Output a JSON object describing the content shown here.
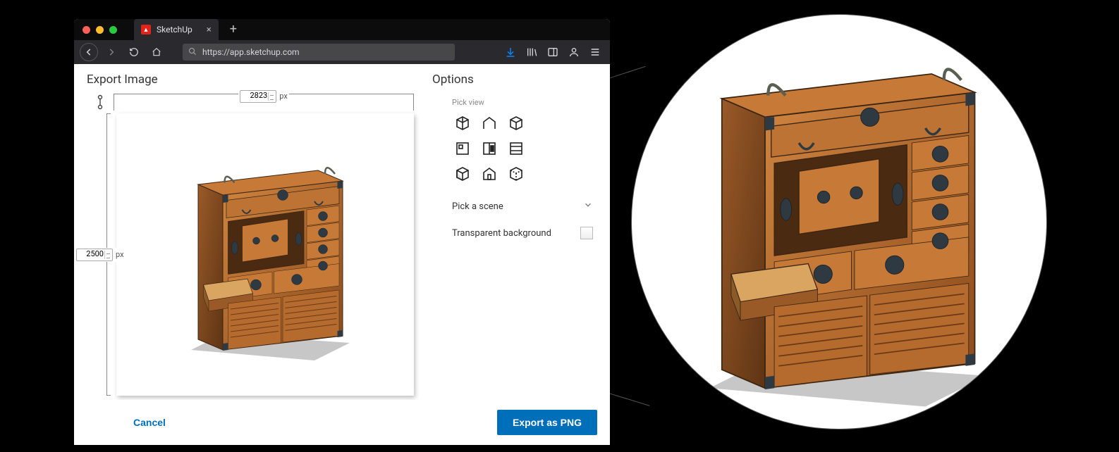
{
  "browser": {
    "tab_title": "SketchUp",
    "url": "https://app.sketchup.com",
    "traffic_colors": {
      "close": "#ff5f57",
      "min": "#febc2e",
      "max": "#28c840"
    }
  },
  "dialog": {
    "title": "Export Image",
    "width_value": "2823",
    "height_value": "2500",
    "px_unit": "px",
    "cancel_label": "Cancel",
    "export_label": "Export as PNG"
  },
  "options": {
    "title": "Options",
    "pick_view_label": "Pick view",
    "pick_scene_label": "Pick a scene",
    "transparent_label": "Transparent background"
  }
}
